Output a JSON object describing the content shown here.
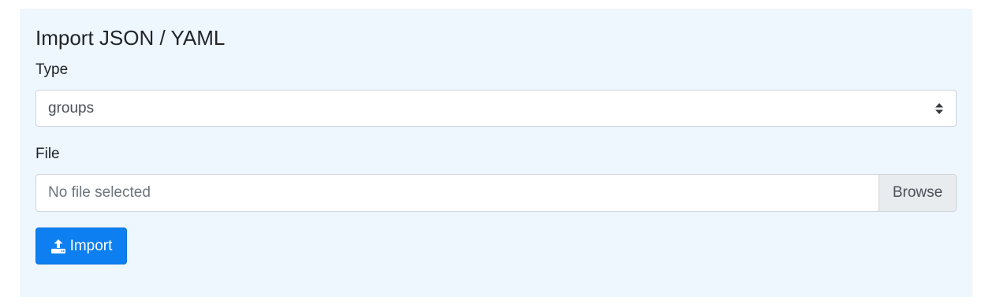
{
  "panel": {
    "title": "Import JSON / YAML"
  },
  "type_field": {
    "label": "Type",
    "selected": "groups",
    "caret_icon": "sort-caret-icon"
  },
  "file_field": {
    "label": "File",
    "placeholder": "No file selected",
    "browse_label": "Browse"
  },
  "import_button": {
    "label": "Import",
    "icon": "upload-icon"
  },
  "colors": {
    "panel_bg": "#eef6fe",
    "primary": "#0d7ff0",
    "browse_bg": "#e9ecef"
  }
}
